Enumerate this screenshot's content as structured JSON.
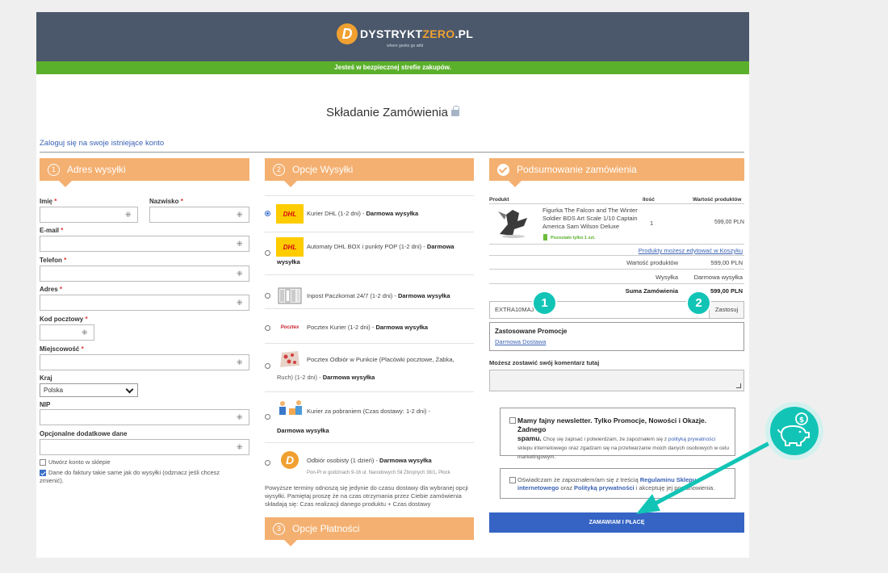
{
  "header": {
    "logo_letter": "D",
    "logo_part1": "DYSTRYKT",
    "logo_part2": "ZERO",
    "logo_part3": ".PL",
    "logo_tagline": "where geeks go wild",
    "safe_zone": "Jesteś w bezpiecznej strefie zakupów."
  },
  "page_title": "Składanie Zamówienia",
  "login_link": "Zaloguj się na swoje istniejące konto",
  "address": {
    "step": "1",
    "title": "Adres wysyłki",
    "first_name": "Imię",
    "last_name": "Nazwisko",
    "email": "E-mail",
    "phone": "Telefon",
    "street": "Adres",
    "postcode": "Kod pocztowy",
    "city": "Miejscowość",
    "country_label": "Kraj",
    "country_value": "Polska",
    "nip": "NIP",
    "extra": "Opcjonalne dodatkowe dane",
    "create_account": "Utwórz konto w sklepie",
    "invoice_same_1": "Dane do faktury takie same jak do wysyłki (odznacz jeśli chcesz",
    "invoice_same_2": "zmienić)."
  },
  "shipping": {
    "step": "2",
    "title": "Opcje Wysyłki",
    "options": [
      {
        "logo": "DHL",
        "text": "Kurier DHL (1-2 dni) - ",
        "bold": "Darmowa wysyłka"
      },
      {
        "logo": "DHL",
        "text": "Automaty DHL BOX i punkty POP (1-2 dni) - ",
        "bold": "Darmowa",
        "bold2": "wysyłka"
      },
      {
        "text": "Inpost Paczkomat 24/7 (1-2 dni) - ",
        "bold": "Darmowa wysyłka"
      },
      {
        "logo": "Pocztex",
        "text": "Pocztex Kurier (1-2 dni) - ",
        "bold": "Darmowa wysyłka"
      },
      {
        "text": "Pocztex Odbiór w Punkcie (Placówki pocztowe, Żabka,",
        "text2": "Ruch) (1-2 dni) - ",
        "bold": "Darmowa wysyłka"
      },
      {
        "text": "Kurier za pobraniem (Czas dostawy: 1-2 dni) -",
        "bold": "Darmowa wysyłka"
      },
      {
        "logo": "D",
        "text": "Odbiór osobisty (1 dzień) - ",
        "bold": "Darmowa wysyłka",
        "sub": "Pon-Pt w godzinach 9-16 ul. Narodowych Sił Zbrojnych 38/1, Płock"
      }
    ],
    "note_1": "Powyższe terminy odnoszą się jedynie do czasu dostawy dla wybranej opcji",
    "note_2": "wysyłki. Pamiętaj proszę że na czas otrzymania przez Ciebie zamówienia",
    "note_3": "składają się: Czas realizacji danego produktu + Czas dostawy"
  },
  "payment": {
    "step": "3",
    "title": "Opcje Płatności"
  },
  "summary": {
    "title": "Podsumowanie zamówienia",
    "col_product": "Produkt",
    "col_qty": "Ilość",
    "col_value": "Wartość produktów",
    "product_name_1": "Figurka The Falcon and The Winter",
    "product_name_2": "Soldier BDS Art Scale 1/10 Captain",
    "product_name_3": "America Sam Wilson Deluxe",
    "stock": "Pozostało tylko 1 szt.",
    "qty": "1",
    "price": "599,00 PLN",
    "edit_link": "Produkty możesz edytować w Koszyku",
    "products_value_label": "Wartość produktów",
    "products_value": "599,00 PLN",
    "shipping_label": "Wysyłka",
    "shipping_value": "Darmowa wysyłka",
    "total_label": "Suma Zamówienia",
    "total_value": "599,00 PLN",
    "coupon_value": "EXTRA10MAJ",
    "apply_label": "Zastosuj",
    "promo_title": "Zastosowane Promocje",
    "promo_value": "Darmowa Dostawa",
    "comment_label": "Możesz zostawić swój komentarz tutaj",
    "newsletter_title_1": "Mamy fajny newsletter. Tylko Promocje, Nowości i Okazje. Żadnego",
    "newsletter_title_2": "spamu.",
    "newsletter_body_1": " Chcę się zapisać i potwierdzam, że zapoznałem się z ",
    "newsletter_link": "polityką prywatności",
    "newsletter_body_2": "sklepu internetowego oraz zgadzam się na przetwarzanie moich danych osobowych w celu",
    "newsletter_body_3": "marketingowym.",
    "terms_1": "Oświadczam że zapoznałem/am się z treścią ",
    "terms_link1": "Regulaminu Sklepu",
    "terms_link1b": "internetowego",
    "terms_2": " oraz ",
    "terms_link2": "Polityką prywatności",
    "terms_3": " i akceptuję jej postanowienia.",
    "order_button": "ZAMAWIAM I PŁACĘ"
  },
  "annotations": {
    "badge1": "1",
    "badge2": "2",
    "coin": "$"
  },
  "colors": {
    "header": "#4b586b",
    "safe": "#5bb02b",
    "section": "#f4b071",
    "order": "#3564c5",
    "teal": "#12c4b6"
  }
}
